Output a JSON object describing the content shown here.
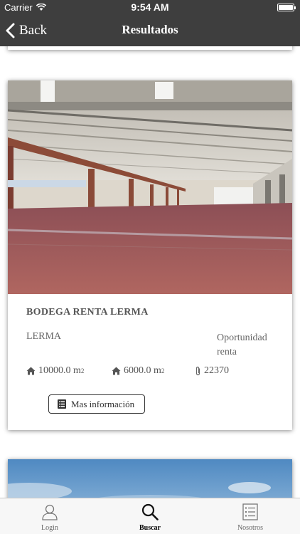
{
  "status_bar": {
    "carrier": "Carrier",
    "time": "9:54 AM",
    "wifi_icon": "wifi-icon",
    "battery_icon": "battery-icon"
  },
  "nav": {
    "back_label": "Back",
    "title": "Resultados"
  },
  "listing": {
    "title": "BODEGA RENTA LERMA",
    "location": "LERMA",
    "category": "Oportunidad renta",
    "area_total": "10000.0 m",
    "area_built": "6000.0 m",
    "area_unit_sup": "2",
    "id": "22370",
    "more_info_label": "Mas información",
    "icons": {
      "area": "house-icon",
      "id": "paperclip-icon",
      "more_info": "list-icon"
    }
  },
  "tabs": [
    {
      "label": "Login",
      "icon": "user-icon"
    },
    {
      "label": "Buscar",
      "icon": "search-icon"
    },
    {
      "label": "Nosotros",
      "icon": "list-icon"
    }
  ],
  "colors": {
    "bar": "#3e3e3e",
    "tab_bar": "#f7f7f7",
    "floor": "#9e5558"
  }
}
